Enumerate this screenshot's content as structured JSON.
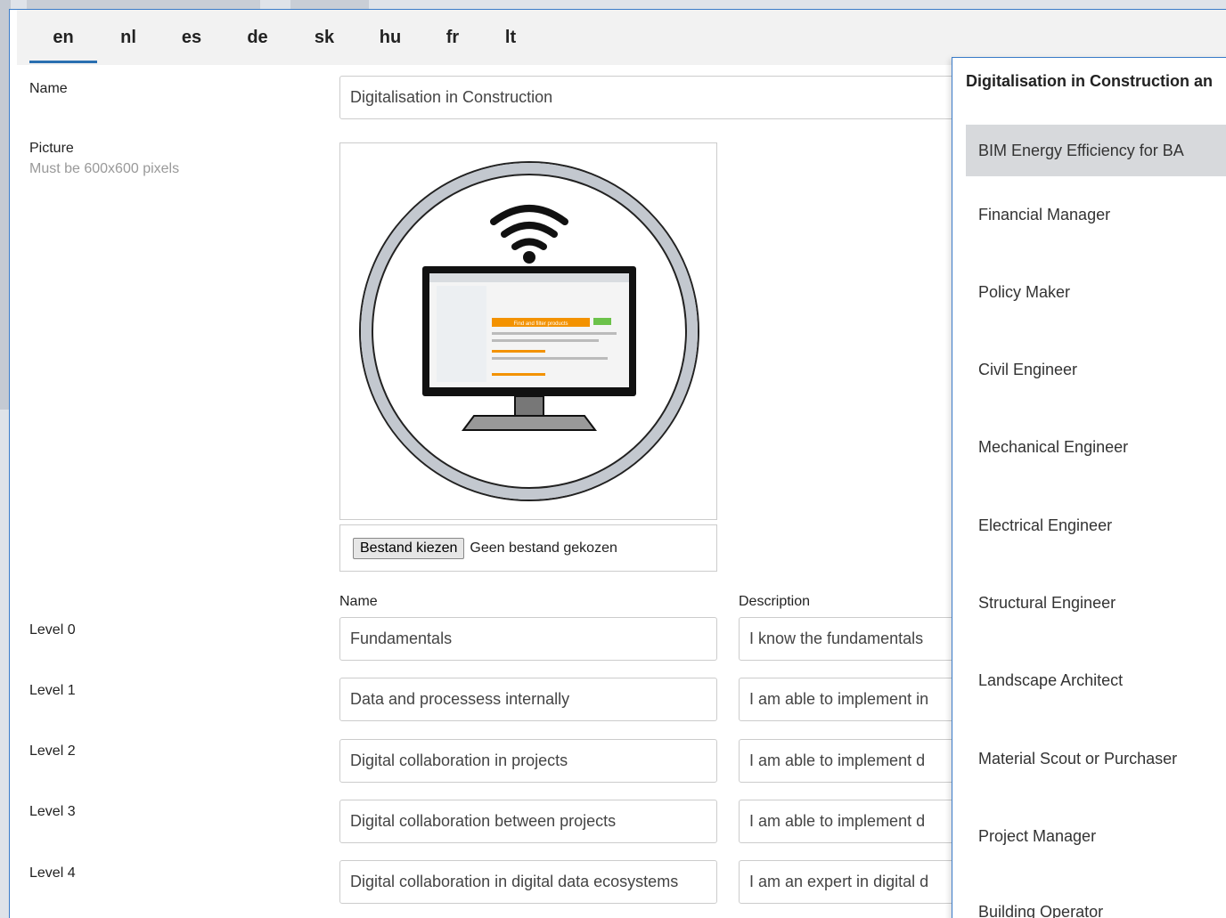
{
  "language_tabs": [
    "en",
    "nl",
    "es",
    "de",
    "sk",
    "hu",
    "fr",
    "lt"
  ],
  "active_tab": "en",
  "form": {
    "name_label": "Name",
    "name_value": "Digitalisation in Construction",
    "picture_label": "Picture",
    "picture_hint": "Must be 600x600 pixels",
    "file_button": "Bestand kiezen",
    "file_status": "Geen bestand gekozen",
    "col_name": "Name",
    "col_description": "Description",
    "levels": [
      {
        "label": "Level 0",
        "name": "Fundamentals",
        "description": "I know the fundamentals"
      },
      {
        "label": "Level 1",
        "name": "Data and processess internally",
        "description": "I am able to implement in"
      },
      {
        "label": "Level 2",
        "name": "Digital collaboration in projects",
        "description": "I am able to implement d"
      },
      {
        "label": "Level 3",
        "name": "Digital collaboration between projects",
        "description": "I am able to implement d"
      },
      {
        "label": "Level 4",
        "name": "Digital collaboration in digital data ecosystems",
        "description": "I am an expert in digital d"
      }
    ]
  },
  "dropdown": {
    "title": "Digitalisation in Construction an",
    "items": [
      "BIM Energy Efficiency for BA",
      "Financial Manager",
      "Policy Maker",
      "Civil Engineer",
      "Mechanical Engineer",
      "Electrical Engineer",
      "Structural Engineer",
      "Landscape Architect",
      "Material Scout or Purchaser",
      "Project Manager",
      "Building Operator"
    ],
    "selected_index": 0
  },
  "picture": {
    "icon": "wifi-monitor-icon",
    "banner_text": "Find and filter products",
    "ring_color": "#aab0b8",
    "banner_color": "#f39200"
  }
}
